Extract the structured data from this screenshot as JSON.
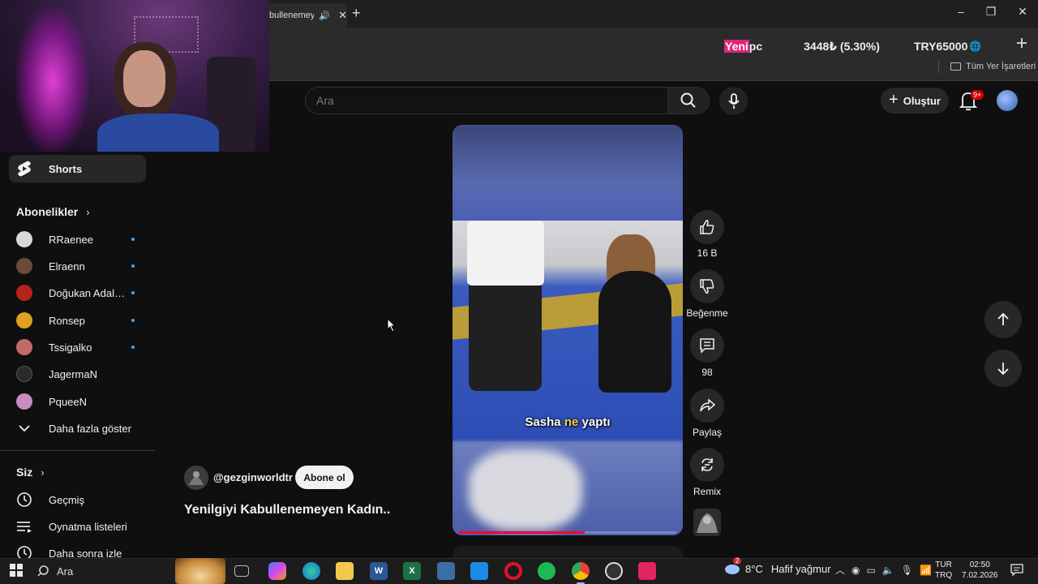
{
  "browser": {
    "tab_title": "bullenemeyen",
    "new_tab": "+",
    "window_controls": {
      "minimize": "–",
      "maximize": "❐",
      "close": "✕"
    },
    "bookmarks_folder": "Tüm Yer İşaretleri"
  },
  "ticker": {
    "highlight": "Yeni",
    "label": " pc",
    "amount": "3448₺ (5.30%)",
    "goal": "TRY65000"
  },
  "header": {
    "search_placeholder": "Ara",
    "create_label": "Oluştur",
    "notifications_badge": "9+"
  },
  "sidebar": {
    "shorts_label": "Shorts",
    "subscriptions_title": "Abonelikler",
    "subscriptions": [
      {
        "name": "RRaenee",
        "color": "#d9d9d9",
        "new": true
      },
      {
        "name": "Elraenn",
        "color": "#6b4a3a",
        "new": true
      },
      {
        "name": "Doğukan Adal [T...",
        "color": "#b3241c",
        "new": true
      },
      {
        "name": "Ronsep",
        "color": "#e0a020",
        "new": true
      },
      {
        "name": "Tssigalko",
        "color": "#c06a6a",
        "new": true
      },
      {
        "name": "JagermaN",
        "color": "#2a2a2a",
        "new": false
      },
      {
        "name": "PqueeN",
        "color": "#c88ac0",
        "new": false
      }
    ],
    "show_more": "Daha fazla göster",
    "you_title": "Siz",
    "you_items": [
      {
        "label": "Geçmiş",
        "icon": "history-icon"
      },
      {
        "label": "Oynatma listeleri",
        "icon": "playlist-icon"
      },
      {
        "label": "Daha sonra izle",
        "icon": "watch-later-icon"
      }
    ]
  },
  "video": {
    "caption_pre": "Sasha ",
    "caption_highlight": "ne",
    "caption_post": " yaptı",
    "progress": 0.58,
    "channel": "@gezginworldtr",
    "subscribe_label": "Abone ol",
    "title": "Yenilgiyi Kabullenemeyen Kadın.."
  },
  "actions": {
    "like_count": "16 B",
    "dislike_label": "Beğenme",
    "comment_count": "98",
    "share_label": "Paylaş",
    "remix_label": "Remix"
  },
  "taskbar": {
    "search_label": "Ara",
    "apps": [
      "task-view",
      "copilot",
      "edge",
      "file-explorer",
      "word",
      "excel",
      "calculator",
      "store",
      "opera",
      "spotify",
      "chrome",
      "obs",
      "app-red"
    ],
    "weather_badge": "2",
    "weather_temp": "8°C",
    "weather_desc": "Hafif yağmur",
    "lang_top": "TUR",
    "lang_bottom": "TRQ",
    "time": "02:50",
    "date": "7.02.2026"
  },
  "colors": {
    "background": "#0f0f0f",
    "accent_red": "#ff0033",
    "ticker_pink": "#e0247d",
    "link_blue": "#3ea6ff"
  }
}
